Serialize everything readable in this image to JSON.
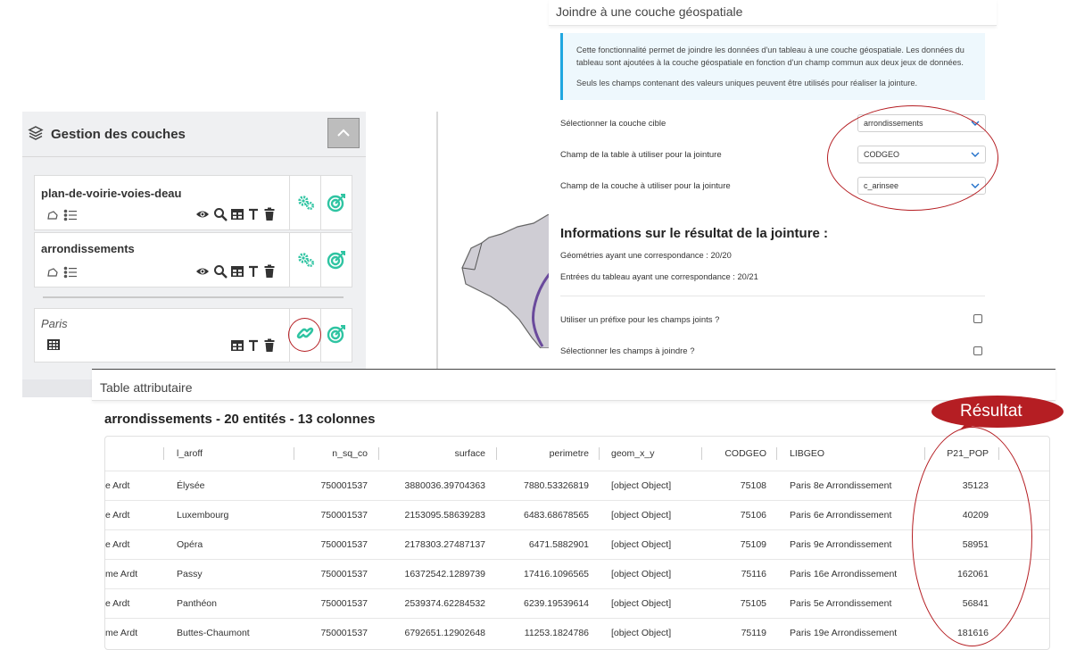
{
  "layers_panel": {
    "title": "Gestion des couches",
    "layers": [
      {
        "name": "plan-de-voirie-voies-deau",
        "italic": false
      },
      {
        "name": "arrondissements",
        "italic": false
      },
      {
        "name": "Paris",
        "italic": true
      }
    ]
  },
  "join_panel": {
    "title": "Joindre à une couche géospatiale",
    "info_line1": "Cette fonctionnalité permet de joindre les données d'un tableau à une couche géospatiale. Les données du",
    "info_line2": "tableau sont ajoutées à la couche géospatiale en fonction d'un champ commun aux deux jeux de données.",
    "info_line3": "Seuls les champs contenant des valeurs uniques peuvent être utilisés pour réaliser la jointure.",
    "target_layer_label": "Sélectionner la couche cible",
    "target_layer_value": "arrondissements",
    "table_field_label": "Champ de la table à utiliser pour la jointure",
    "table_field_value": "CODGEO",
    "layer_field_label": "Champ de la couche à utiliser pour la jointure",
    "layer_field_value": "c_arinsee",
    "result_heading": "Informations sur le résultat de la jointure :",
    "geom_match_label": "Géométries ayant une correspondance :",
    "geom_match_value": "20/20",
    "table_match_label": "Entrées du tableau ayant une correspondance :",
    "table_match_value": "20/21",
    "prefix_label": "Utiliser un préfixe pour les champs joints ?",
    "select_fields_label": "Sélectionner les champs à joindre ?"
  },
  "attr_table": {
    "title": "Table attributaire",
    "subtitle": "arrondissements - 20 entités - 13 colonnes",
    "columns": [
      "l_aroff",
      "n_sq_co",
      "surface",
      "perimetre",
      "geom_x_y",
      "CODGEO",
      "LIBGEO",
      "P21_POP"
    ],
    "rows": [
      [
        "e Ardt",
        "Élysée",
        "750001537",
        "3880036.39704363",
        "7880.53326819",
        "[object Object]",
        "75108",
        "Paris 8e Arrondissement",
        "35123"
      ],
      [
        "e Ardt",
        "Luxembourg",
        "750001537",
        "2153095.58639283",
        "6483.68678565",
        "[object Object]",
        "75106",
        "Paris 6e Arrondissement",
        "40209"
      ],
      [
        "e Ardt",
        "Opéra",
        "750001537",
        "2178303.27487137",
        "6471.5882901",
        "[object Object]",
        "75109",
        "Paris 9e Arrondissement",
        "58951"
      ],
      [
        "me Ardt",
        "Passy",
        "750001537",
        "16372542.1289739",
        "17416.1096565",
        "[object Object]",
        "75116",
        "Paris 16e Arrondissement",
        "162061"
      ],
      [
        "e Ardt",
        "Panthéon",
        "750001537",
        "2539374.62284532",
        "6239.19539614",
        "[object Object]",
        "75105",
        "Paris 5e Arrondissement",
        "56841"
      ],
      [
        "me Ardt",
        "Buttes-Chaumont",
        "750001537",
        "6792651.12902648",
        "11253.1824786",
        "[object Object]",
        "75119",
        "Paris 19e Arrondissement",
        "181616"
      ]
    ]
  },
  "annotations": {
    "result_bubble": "Résultat",
    "accent_color": "#b51e23",
    "tool_color": "#2fc4a2"
  }
}
